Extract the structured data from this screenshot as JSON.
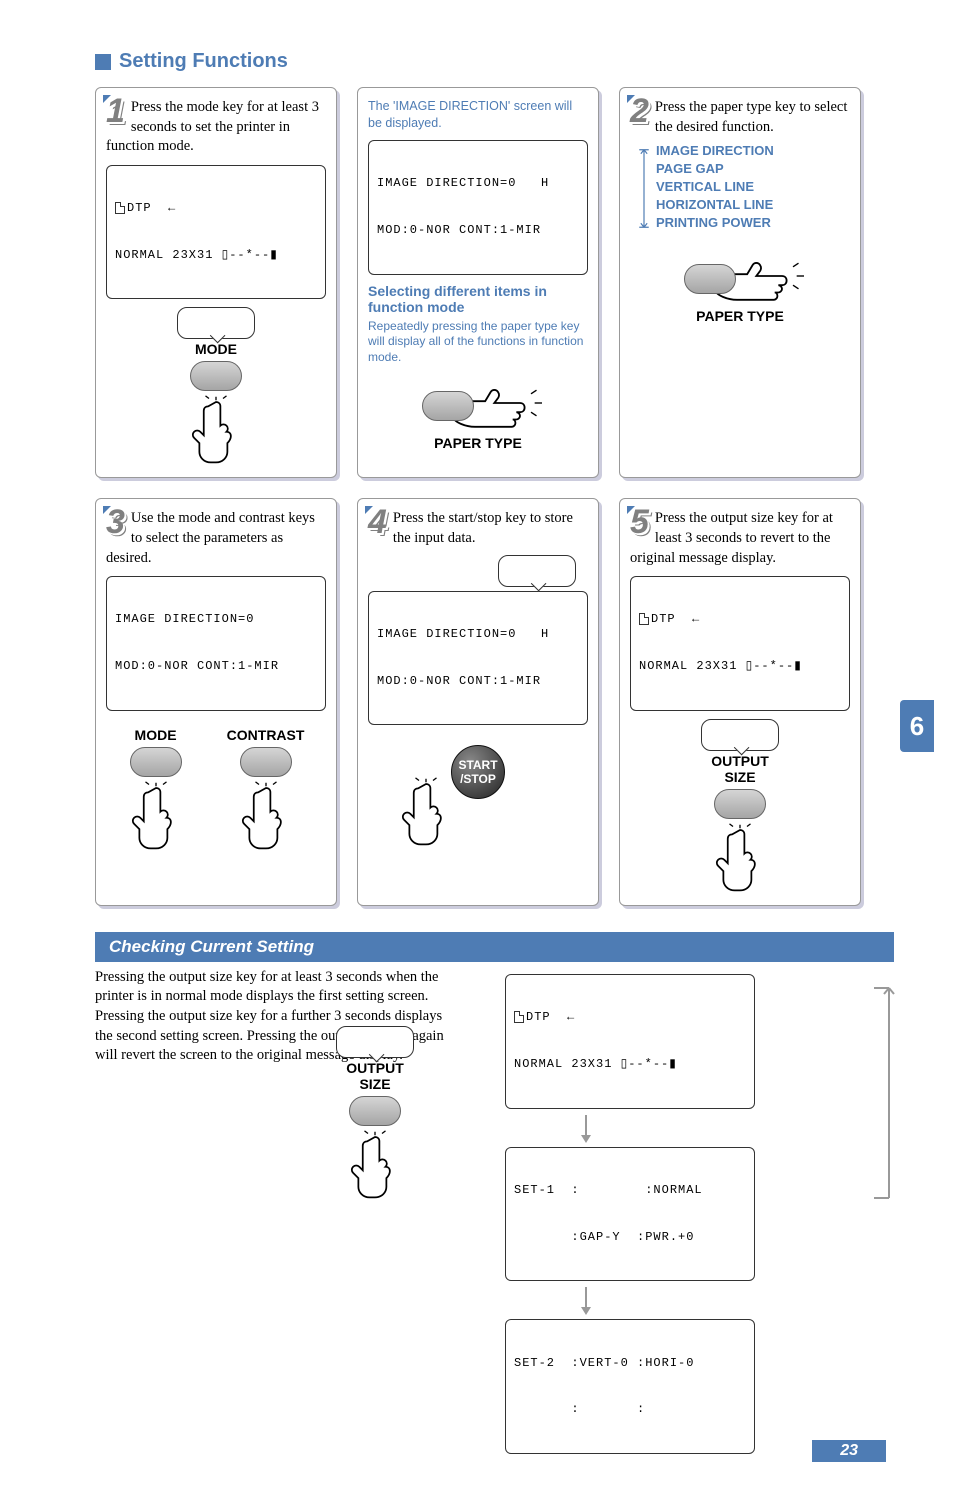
{
  "section_title": "Setting Functions",
  "side_tab": "6",
  "page_number": "23",
  "steps": {
    "1": {
      "num": "1",
      "text": "Press the mode key for at least 3 seconds to set the printer in function mode.",
      "lcd_line1": "DTP  ←",
      "lcd_line2": "NORMAL 23X31 ▯--*--▮",
      "button_label": "MODE"
    },
    "mid": {
      "intro": "The 'IMAGE DIRECTION' screen will be displayed.",
      "lcd_line1": "IMAGE DIRECTION=0   H",
      "lcd_line2": "MOD:0-NOR CONT:1-MIR",
      "sub_heading": "Selecting different items in function mode",
      "body": "Repeatedly pressing the paper type key will display all of the functions in function mode.",
      "button_label": "PAPER TYPE"
    },
    "2": {
      "num": "2",
      "text": "Press the paper type key to select the desired function.",
      "functions": [
        "IMAGE DIRECTION",
        "PAGE GAP",
        "VERTICAL LINE",
        "HORIZONTAL LINE",
        "PRINTING POWER"
      ],
      "button_label": "PAPER TYPE"
    },
    "3": {
      "num": "3",
      "text": "Use the mode and contrast keys to select the parameters as desired.",
      "lcd_line1": "IMAGE DIRECTION=0",
      "lcd_line2": "MOD:0-NOR CONT:1-MIR",
      "button_label_a": "MODE",
      "button_label_b": "CONTRAST"
    },
    "4": {
      "num": "4",
      "text": "Press the start/stop key to store the input data.",
      "lcd_line1": "IMAGE DIRECTION=0   H",
      "lcd_line2": "MOD:0-NOR CONT:1-MIR",
      "button_label": "START\n/STOP"
    },
    "5": {
      "num": "5",
      "text": "Press the output size key for at least 3 seconds to revert to the original message display.",
      "lcd_line1": "DTP  ←",
      "lcd_line2": "NORMAL 23X31 ▯--*--▮",
      "button_label_a": "OUTPUT",
      "button_label_b": "SIZE"
    }
  },
  "checking": {
    "title": "Checking Current Setting",
    "text": "Pressing the output size key for at least 3 seconds when the printer is in normal mode displays the first setting screen. Pressing the output size key for a further 3 seconds displays the second setting screen.  Pressing the output size key again will revert the screen to the original message display.",
    "button_label_a": "OUTPUT",
    "button_label_b": "SIZE",
    "lcd0_line1": "DTP  ←",
    "lcd0_line2": "NORMAL 23X31 ▯--*--▮",
    "lcd1_line1": "SET-1  :        :NORMAL",
    "lcd1_line2": "       :GAP-Y  :PWR.+0",
    "lcd2_line1": "SET-2  :VERT-0 :HORI-0",
    "lcd2_line2": "       :       :"
  }
}
